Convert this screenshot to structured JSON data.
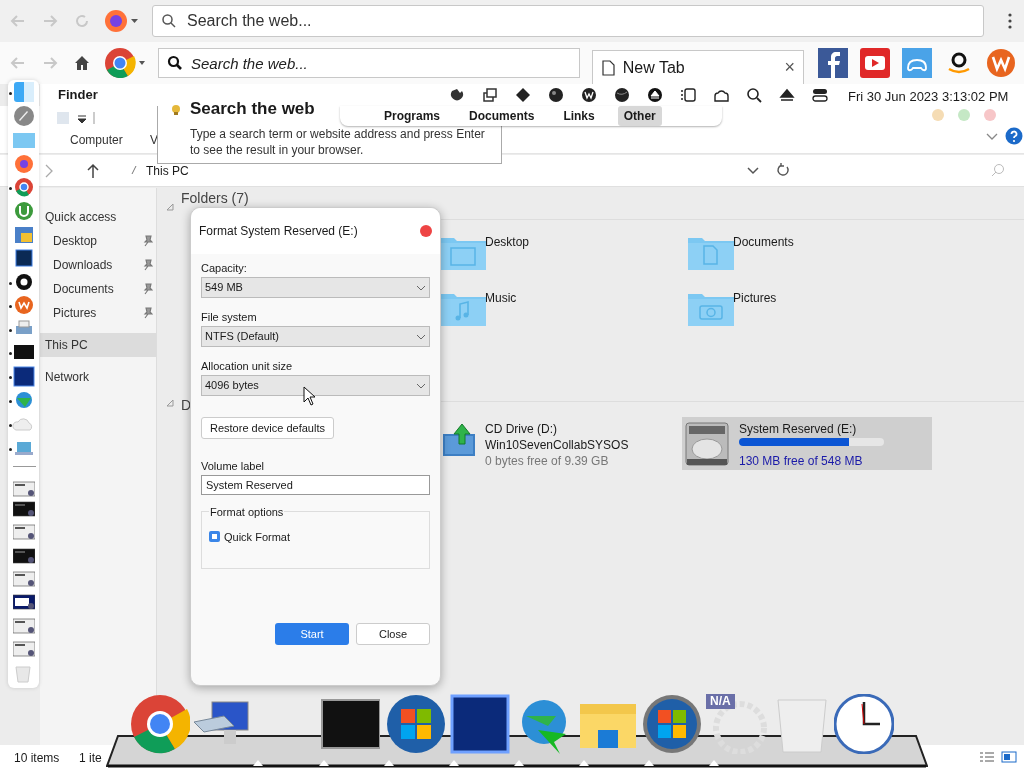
{
  "firefox_bar": {
    "search_placeholder": "Search the web..."
  },
  "chrome_bar": {
    "search_placeholder": "Search the web...",
    "tab": {
      "title": "New Tab",
      "close": "×"
    }
  },
  "menu_bar": {
    "app": "Finder",
    "clock": "Fri 30 Jun 2023 3:13:02 PM"
  },
  "search_tooltip": {
    "title": "Search the web",
    "text": "Type a search term or website address and press Enter to see the result in your browser."
  },
  "category_menu": [
    {
      "label": "Programs",
      "selected": false
    },
    {
      "label": "Documents",
      "selected": false
    },
    {
      "label": "Links",
      "selected": false
    },
    {
      "label": "Other",
      "selected": true
    }
  ],
  "left_dock": [
    {
      "running": true
    },
    {
      "running": false
    },
    {
      "running": false
    },
    {
      "running": false
    },
    {
      "running": true
    },
    {
      "running": false
    },
    {
      "running": false
    },
    {
      "running": false
    },
    {
      "running": true
    },
    {
      "running": true
    },
    {
      "running": true
    },
    {
      "running": true
    },
    {
      "running": true
    },
    {
      "running": true
    },
    {
      "running": true
    },
    {
      "running": true
    }
  ],
  "explorer": {
    "ribbon_tabs": [
      "Computer",
      "V"
    ],
    "path": "This PC",
    "nav": [
      {
        "label": "Quick access",
        "pinned": false,
        "selected": false,
        "indent": false
      },
      {
        "label": "Desktop",
        "pinned": true,
        "selected": false,
        "indent": true
      },
      {
        "label": "Downloads",
        "pinned": true,
        "selected": false,
        "indent": true
      },
      {
        "label": "Documents",
        "pinned": true,
        "selected": false,
        "indent": true
      },
      {
        "label": "Pictures",
        "pinned": true,
        "selected": false,
        "indent": true
      },
      {
        "label": "This PC",
        "pinned": false,
        "selected": true,
        "indent": false
      },
      {
        "label": "Network",
        "pinned": false,
        "selected": false,
        "indent": false
      }
    ],
    "folders_header": "Folders (7)",
    "folders": [
      {
        "name": "Desktop",
        "kind": "desktop"
      },
      {
        "name": "Documents",
        "kind": "document"
      },
      {
        "name": "Music",
        "kind": "music"
      },
      {
        "name": "Pictures",
        "kind": "camera"
      }
    ],
    "drives_header": "D",
    "drives": [
      {
        "kind": "cd",
        "name": "CD Drive (D:)",
        "label": "Win10SevenCollabSYSOS",
        "free": "0 bytes free of 9.39 GB",
        "selected": false
      },
      {
        "kind": "disk",
        "name": "System Reserved (E:)",
        "free": "130 MB free of 548 MB",
        "level": 0.76,
        "selected": true
      }
    ],
    "status": [
      "10 items",
      "1 ite"
    ]
  },
  "dialog": {
    "title": "Format System Reserved (E:)",
    "fields": [
      {
        "label": "Capacity:",
        "value": "549 MB"
      },
      {
        "label": "File system",
        "value": "NTFS (Default)"
      },
      {
        "label": "Allocation unit size",
        "value": "4096 bytes"
      }
    ],
    "restore_button": "Restore device defaults",
    "volume_label": {
      "label": "Volume label",
      "value": "System Reserved"
    },
    "options_group": "Format options",
    "quick_format": {
      "label": "Quick Format",
      "checked": true
    },
    "buttons": [
      {
        "label": "Start",
        "primary": true
      },
      {
        "label": "Close",
        "primary": false
      }
    ]
  },
  "bottom_dock": {
    "badge": "N/A"
  }
}
